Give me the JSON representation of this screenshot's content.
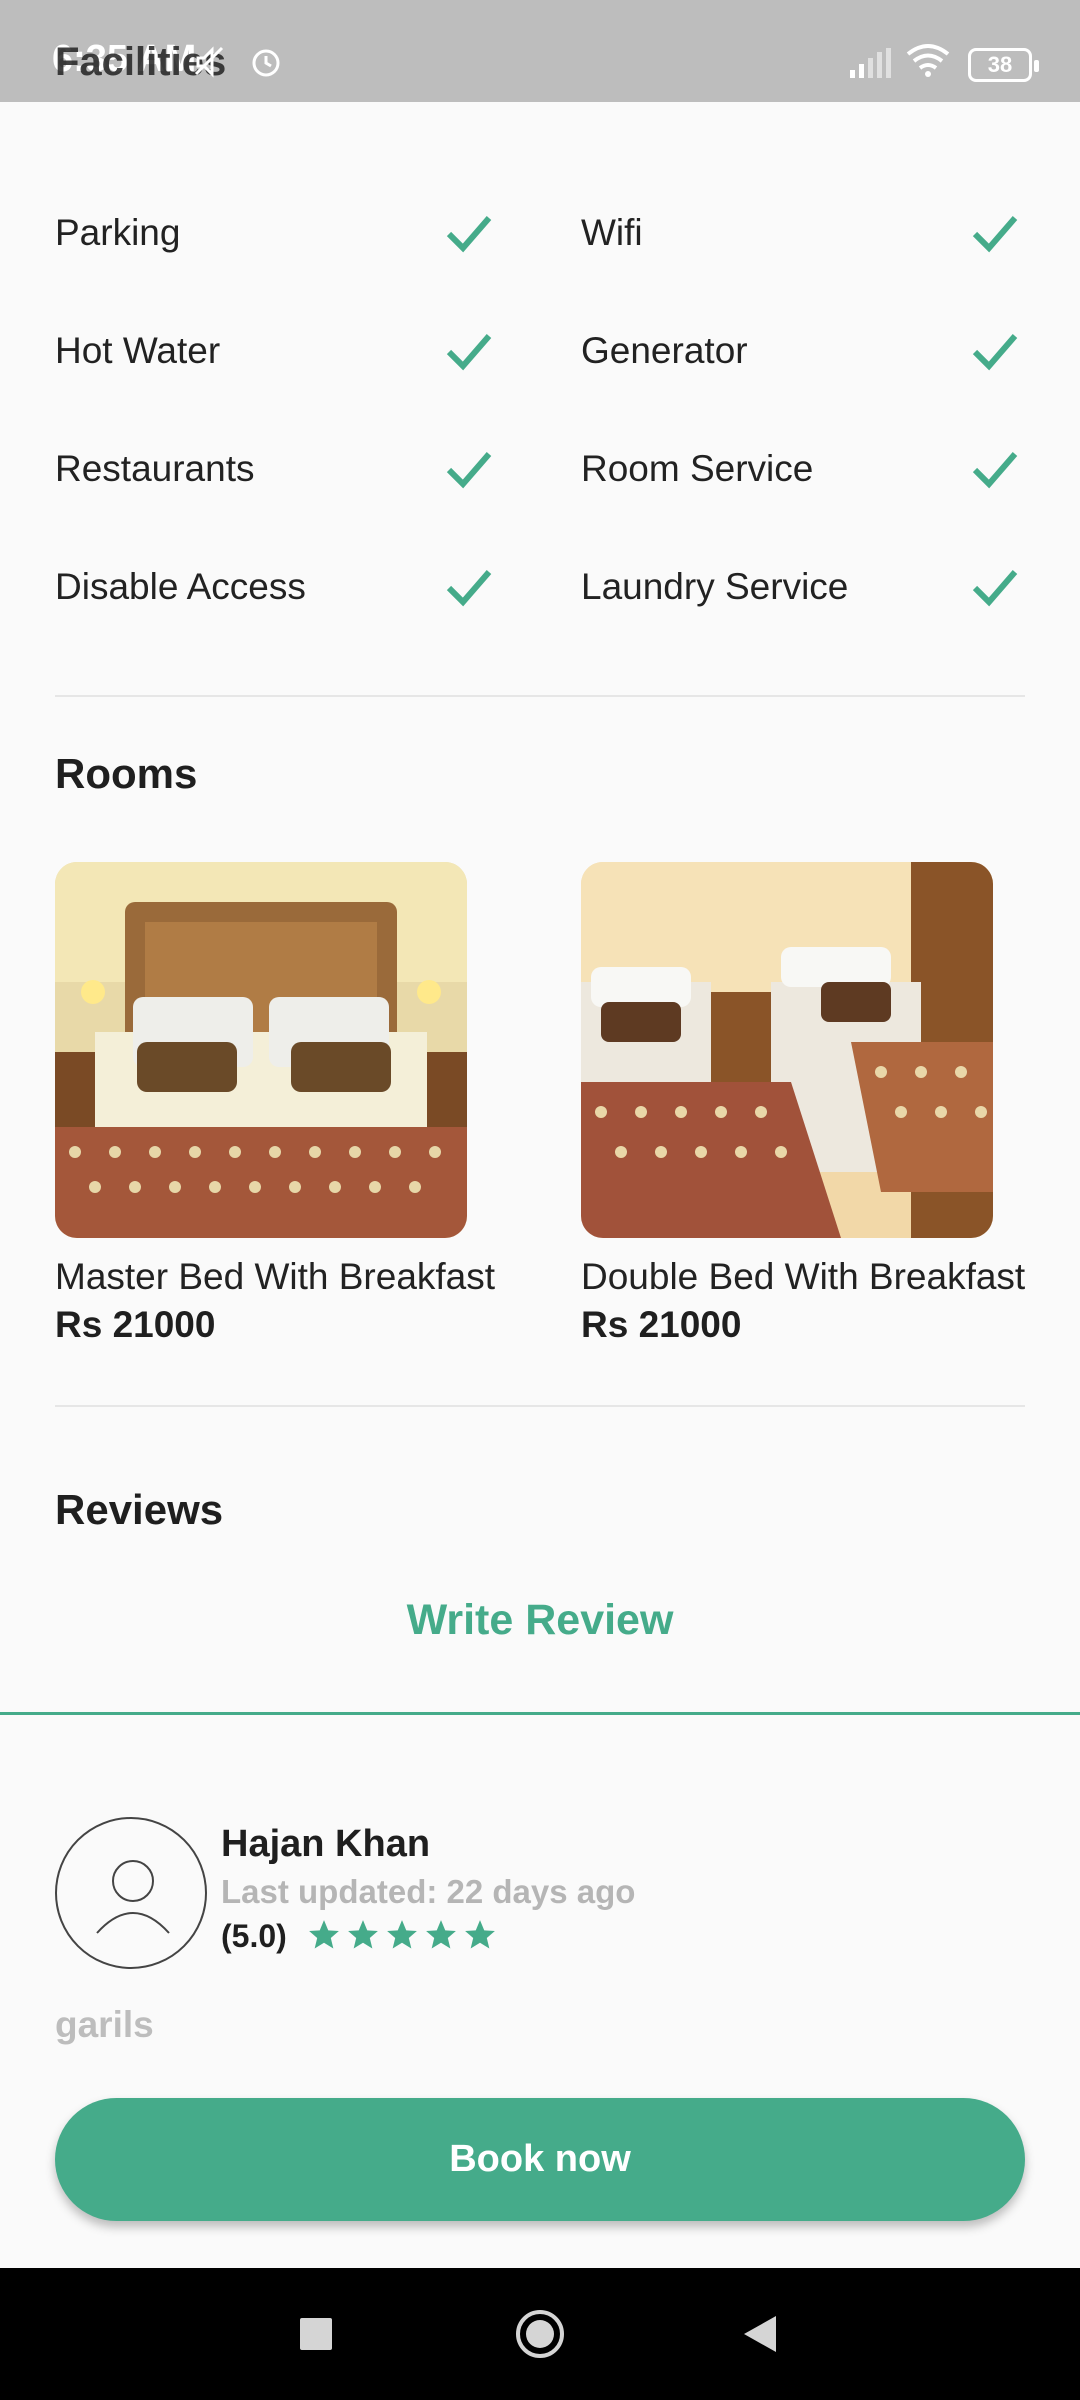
{
  "status_bar": {
    "time": "6:35 AM",
    "overlapping_title": "Facilities",
    "battery": "38",
    "icons": [
      "mute-icon",
      "alarm-icon",
      "signal-icon",
      "wifi-icon",
      "battery-icon"
    ]
  },
  "facilities": {
    "items": [
      {
        "label": "Parking",
        "available": true
      },
      {
        "label": "Wifi",
        "available": true
      },
      {
        "label": "Hot Water",
        "available": true
      },
      {
        "label": "Generator",
        "available": true
      },
      {
        "label": "Restaurants",
        "available": true
      },
      {
        "label": "Room Service",
        "available": true
      },
      {
        "label": "Disable Access",
        "available": true
      },
      {
        "label": "Laundry Service",
        "available": true
      }
    ]
  },
  "rooms": {
    "title": "Rooms",
    "items": [
      {
        "name": "Master Bed With Breakfast",
        "price": "Rs 21000"
      },
      {
        "name": "Double Bed With Breakfast",
        "price": "Rs 21000"
      }
    ]
  },
  "reviews": {
    "title": "Reviews",
    "write_review_label": "Write Review",
    "items": [
      {
        "name": "Hajan Khan",
        "updated": "Last updated: 22 days ago",
        "score": "(5.0)",
        "stars": 5,
        "text": "garils"
      }
    ]
  },
  "book_button_label": "Book now",
  "colors": {
    "accent": "#45ab8a",
    "status_bar": "#bdbdbd",
    "background": "#fafafa"
  }
}
